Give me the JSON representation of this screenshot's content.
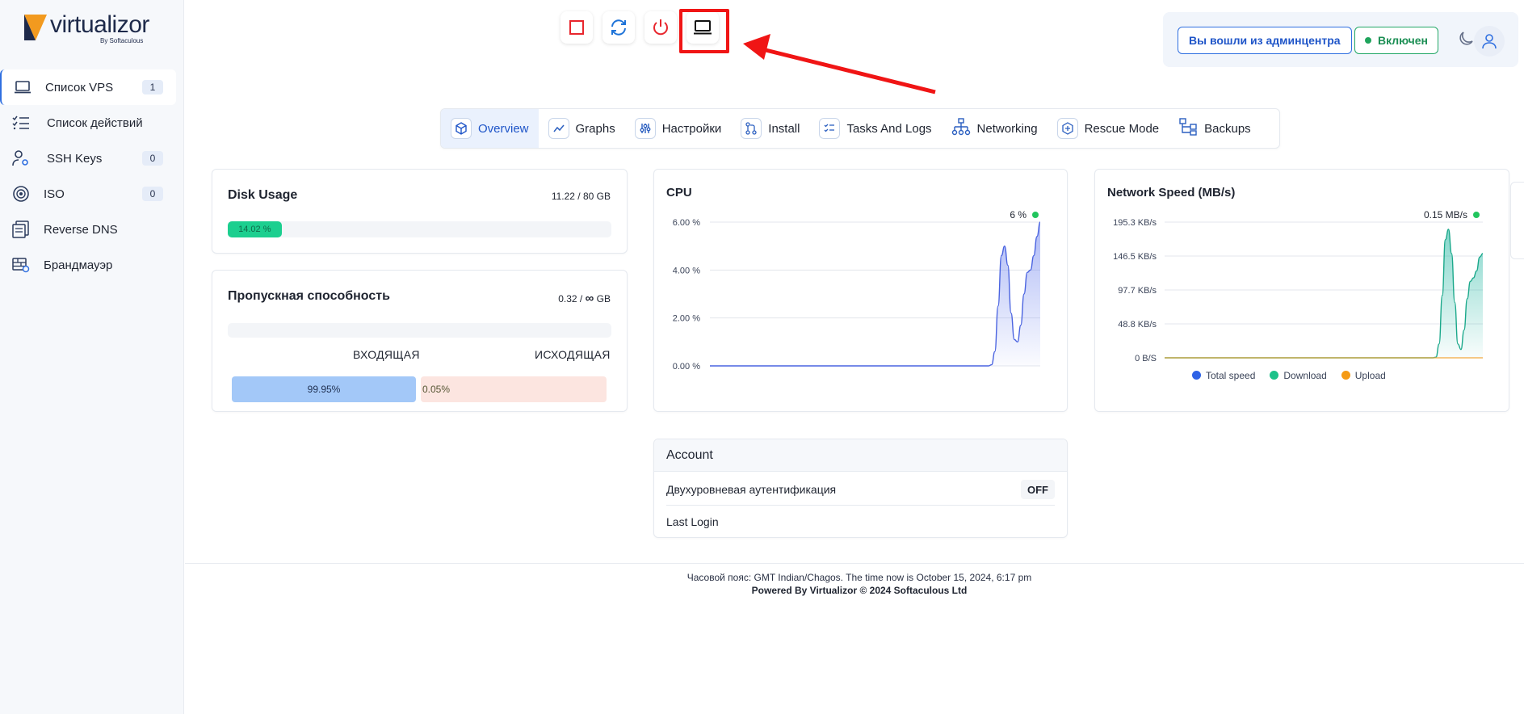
{
  "brand": {
    "name": "virtualizor",
    "byline": "By Softaculous",
    "colors": {
      "accent": "#2f6fe0",
      "logo_orange": "#f29a1f",
      "logo_navy": "#1e2a4a"
    }
  },
  "sidebar": {
    "items": [
      {
        "label": "Список VPS",
        "badge": "1",
        "icon": "laptop-icon"
      },
      {
        "label": "Список действий",
        "badge": "",
        "icon": "checklist-icon"
      },
      {
        "label": "SSH Keys",
        "badge": "0",
        "icon": "user-key-icon"
      },
      {
        "label": "ISO",
        "badge": "0",
        "icon": "disc-icon"
      },
      {
        "label": "Reverse DNS",
        "badge": "",
        "icon": "dns-icon"
      },
      {
        "label": "Брандмауэр",
        "badge": "",
        "icon": "firewall-icon"
      }
    ]
  },
  "header": {
    "actions": [
      {
        "name": "stop",
        "icon": "stop-icon"
      },
      {
        "name": "restart",
        "icon": "refresh-icon"
      },
      {
        "name": "power-off",
        "icon": "power-icon"
      },
      {
        "name": "console",
        "icon": "laptop-icon"
      }
    ],
    "admin_label": "Вы вошли из админцентра",
    "status_label": "Включен"
  },
  "tabs": [
    {
      "label": "Overview",
      "icon": "cube-icon",
      "active": true
    },
    {
      "label": "Graphs",
      "icon": "line-chart-icon"
    },
    {
      "label": "Настройки",
      "icon": "sliders-icon"
    },
    {
      "label": "Install",
      "icon": "git-icon"
    },
    {
      "label": "Tasks And Logs",
      "icon": "tasks-icon"
    },
    {
      "label": "Networking",
      "icon": "network-icon"
    },
    {
      "label": "Rescue Mode",
      "icon": "rescue-icon"
    },
    {
      "label": "Backups",
      "icon": "backup-icon"
    }
  ],
  "disk": {
    "title": "Disk Usage",
    "value": "11.22 / 80 GB",
    "percent_label": "14.02 %",
    "percent": 14.02
  },
  "bandwidth": {
    "title": "Пропускная способность",
    "value_prefix": "0.32 /",
    "value_suffix": "GB",
    "in_label": "ВХОДЯЩАЯ",
    "out_label": "ИСХОДЯЩАЯ",
    "in_percent_label": "99.95%",
    "out_percent_label": "0.05%"
  },
  "cpu": {
    "title": "CPU",
    "current": "6 %",
    "chart_data": {
      "type": "area",
      "yticks": [
        "6.00 %",
        "4.00 %",
        "2.00 %",
        "0.00 %"
      ],
      "ylim": [
        0,
        6
      ],
      "values": [
        0,
        0,
        0,
        0,
        0,
        0,
        0,
        0,
        0,
        0,
        0,
        0,
        0,
        0,
        0,
        0,
        0,
        0,
        0,
        0,
        0,
        0,
        0,
        0,
        0,
        0,
        0,
        0,
        0,
        0,
        0,
        0,
        0,
        0,
        0,
        0,
        0,
        0,
        0,
        0,
        0,
        0,
        0,
        0,
        0,
        0,
        0,
        0,
        0,
        0,
        0,
        0,
        0,
        0,
        0,
        0,
        0,
        0,
        0,
        0,
        0,
        0,
        0,
        0,
        0,
        0,
        0,
        0,
        0,
        0,
        0,
        0,
        0,
        0,
        0,
        0,
        0,
        0,
        0,
        0,
        0,
        0,
        0,
        0,
        0,
        0,
        0,
        0.05,
        0.6,
        2.5,
        4.6,
        5.0,
        4.2,
        2.2,
        1.1,
        1.0,
        1.7,
        3.0,
        3.9,
        4.0,
        4.6,
        5.4,
        6.0
      ]
    }
  },
  "network": {
    "title": "Network Speed (MB/s)",
    "current": "0.15 MB/s",
    "chart_data": {
      "type": "area",
      "yticks": [
        "195.3 KB/s",
        "146.5 KB/s",
        "97.7 KB/s",
        "48.8 KB/s",
        "0 B/S"
      ],
      "ylim": [
        0,
        195.3
      ],
      "series": [
        {
          "name": "Total speed",
          "color": "#2e62e6"
        },
        {
          "name": "Download",
          "color": "#1cc28a",
          "values": [
            0,
            0,
            0,
            0,
            0,
            0,
            0,
            0,
            0,
            0,
            0,
            0,
            0,
            0,
            0,
            0,
            0,
            0,
            0,
            0,
            0,
            0,
            0,
            0,
            0,
            0,
            0,
            0,
            0,
            0,
            0,
            0,
            0,
            0,
            0,
            0,
            0,
            0,
            0,
            0,
            0,
            0,
            0,
            0,
            0,
            0,
            0,
            0,
            0,
            0,
            0,
            0,
            0,
            0,
            0,
            0,
            0,
            0,
            0,
            0,
            0,
            0,
            0,
            0,
            0,
            0,
            0,
            0,
            0,
            0,
            0,
            0,
            0,
            0,
            0,
            0,
            0,
            0,
            0,
            0,
            0,
            0,
            0,
            0,
            0,
            0,
            0,
            1,
            20,
            90,
            170,
            185,
            150,
            80,
            20,
            12,
            40,
            85,
            110,
            115,
            125,
            145,
            150
          ]
        },
        {
          "name": "Upload",
          "color": "#f59a14"
        }
      ]
    }
  },
  "account": {
    "title": "Account",
    "twofa_label": "Двухуровневая аутентификация",
    "twofa_value": "OFF",
    "last_login_label": "Last Login"
  },
  "footer": {
    "timezone": "Часовой пояс: GMT Indian/Chagos. The time now is October 15, 2024, 6:17 pm",
    "powered": "Powered By Virtualizor © 2024 Softaculous Ltd"
  }
}
